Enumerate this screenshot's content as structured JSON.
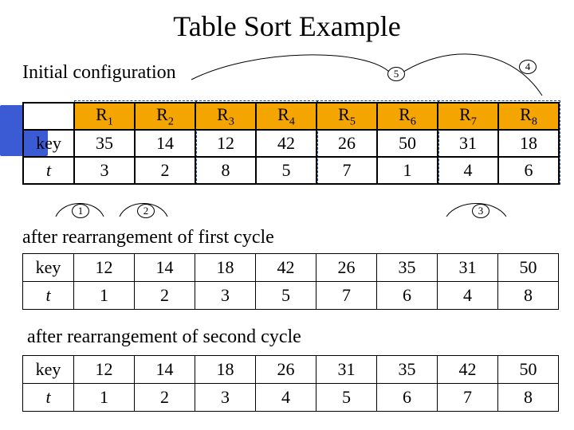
{
  "title": "Table Sort Example",
  "subtitle_initial": "Initial configuration",
  "after_first": "after rearrangement of first cycle",
  "after_second": "after rearrangement of second cycle",
  "row_labels": {
    "key": "key",
    "t": "t"
  },
  "R_label": "R",
  "callouts": {
    "c1": "1",
    "c2": "2",
    "c3": "3",
    "c4": "4",
    "c5": "5"
  },
  "table1": {
    "headers_sub": [
      "1",
      "2",
      "3",
      "4",
      "5",
      "6",
      "7",
      "8"
    ],
    "key": [
      "35",
      "14",
      "12",
      "42",
      "26",
      "50",
      "31",
      "18"
    ],
    "t": [
      "3",
      "2",
      "8",
      "5",
      "7",
      "1",
      "4",
      "6"
    ]
  },
  "table2": {
    "key": [
      "12",
      "14",
      "18",
      "42",
      "26",
      "35",
      "31",
      "50"
    ],
    "t": [
      "1",
      "2",
      "3",
      "5",
      "7",
      "6",
      "4",
      "8"
    ]
  },
  "table3": {
    "key": [
      "12",
      "14",
      "18",
      "26",
      "31",
      "35",
      "42",
      "50"
    ],
    "t": [
      "1",
      "2",
      "3",
      "4",
      "5",
      "6",
      "7",
      "8"
    ]
  },
  "chart_data": {
    "type": "table",
    "title": "Table Sort Example",
    "tables": [
      {
        "name": "Initial configuration",
        "columns": [
          "R1",
          "R2",
          "R3",
          "R4",
          "R5",
          "R6",
          "R7",
          "R8"
        ],
        "rows": {
          "key": [
            35,
            14,
            12,
            42,
            26,
            50,
            31,
            18
          ],
          "t": [
            3,
            2,
            8,
            5,
            7,
            1,
            4,
            6
          ]
        }
      },
      {
        "name": "after rearrangement of first cycle",
        "rows": {
          "key": [
            12,
            14,
            18,
            42,
            26,
            35,
            31,
            50
          ],
          "t": [
            1,
            2,
            3,
            5,
            7,
            6,
            4,
            8
          ]
        }
      },
      {
        "name": "after rearrangement of second cycle",
        "rows": {
          "key": [
            12,
            14,
            18,
            26,
            31,
            35,
            42,
            50
          ],
          "t": [
            1,
            2,
            3,
            4,
            5,
            6,
            7,
            8
          ]
        }
      }
    ],
    "cycle_callouts": [
      1,
      2,
      3,
      4,
      5
    ]
  }
}
